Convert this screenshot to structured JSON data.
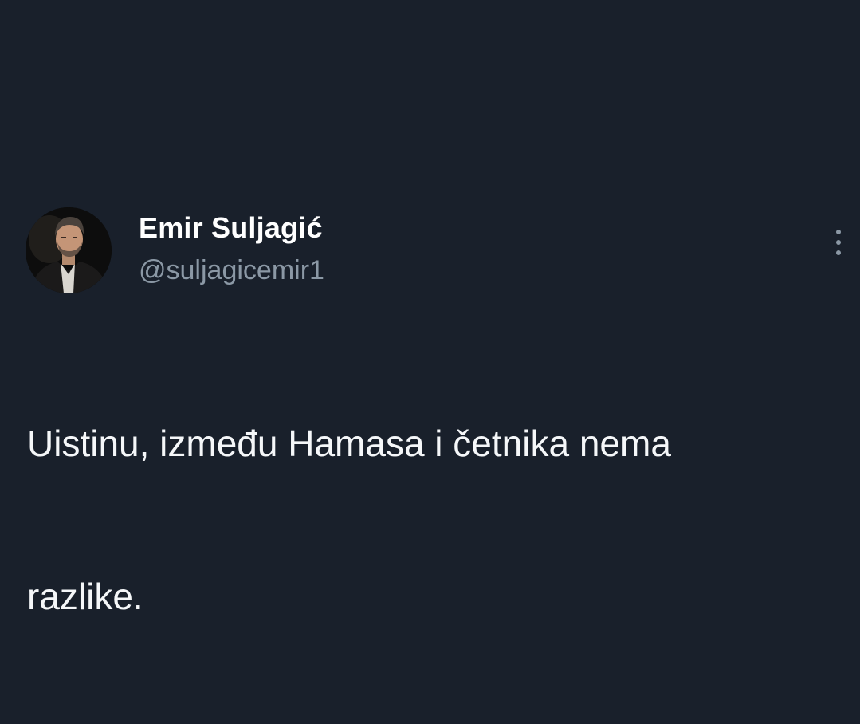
{
  "tweet": {
    "author": {
      "display_name": "Emir Suljagić",
      "handle": "@suljagicemir1",
      "avatar_icon": "profile-photo"
    },
    "text_line_1": "Uistinu, između Hamasa i četnika nema",
    "text_line_2": "razlike.",
    "more_icon": "more-vertical-icon"
  },
  "colors": {
    "background": "#19202b",
    "primary_text": "#ffffff",
    "secondary_text": "#8b98a5"
  }
}
